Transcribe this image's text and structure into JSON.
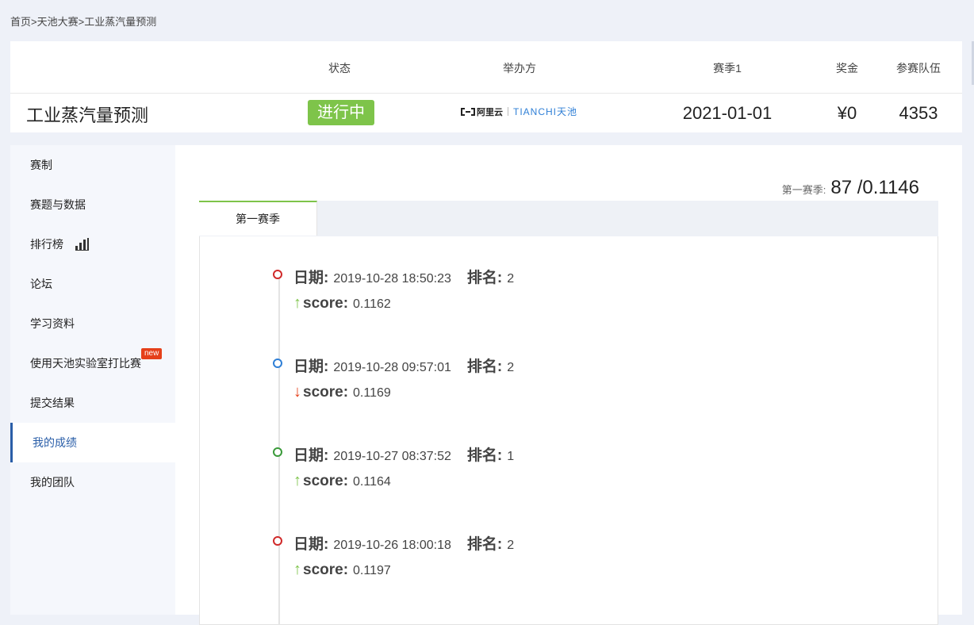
{
  "breadcrumb": {
    "home": "首页",
    "sep": ">",
    "contests": "天池大赛",
    "current": "工业蒸汽量预测"
  },
  "header": {
    "col_status": "状态",
    "col_organizer": "举办方",
    "col_season": "赛季1",
    "col_prize": "奖金",
    "col_teams": "参赛队伍",
    "title": "工业蒸汽量预测",
    "status": "进行中",
    "organizer_aliyun": "阿里云",
    "organizer_tianchi_en": "TIANCHI",
    "organizer_tianchi_cn": "天池",
    "season_date": "2021-01-01",
    "prize": "¥0",
    "teams": "4353"
  },
  "sidebar": {
    "items": [
      {
        "label": "赛制"
      },
      {
        "label": "赛题与数据"
      },
      {
        "label": "排行榜"
      },
      {
        "label": "论坛"
      },
      {
        "label": "学习资料"
      },
      {
        "label": "使用天池实验室打比赛",
        "badge": "new"
      },
      {
        "label": "提交结果"
      },
      {
        "label": "我的成绩"
      },
      {
        "label": "我的团队"
      }
    ]
  },
  "summary": {
    "label": "第一赛季:",
    "value": "87 /0.1146"
  },
  "tabs": [
    {
      "label": "第一赛季"
    }
  ],
  "timeline_labels": {
    "date": "日期:",
    "rank": "排名:",
    "score": "score:"
  },
  "timeline": [
    {
      "date": "2019-10-28 18:50:23",
      "rank": "2",
      "score": "0.1162",
      "trend": "up",
      "dot_color": "#d02a2a"
    },
    {
      "date": "2019-10-28 09:57:01",
      "rank": "2",
      "score": "0.1169",
      "trend": "down",
      "dot_color": "#2f7fd6"
    },
    {
      "date": "2019-10-27 08:37:52",
      "rank": "1",
      "score": "0.1164",
      "trend": "up",
      "dot_color": "#3a9a3a"
    },
    {
      "date": "2019-10-26 18:00:18",
      "rank": "2",
      "score": "0.1197",
      "trend": "up",
      "dot_color": "#d02a2a"
    }
  ],
  "colors": {
    "status_green": "#7ec44a",
    "active_blue": "#2a5ea8",
    "new_red": "#e5401a"
  }
}
